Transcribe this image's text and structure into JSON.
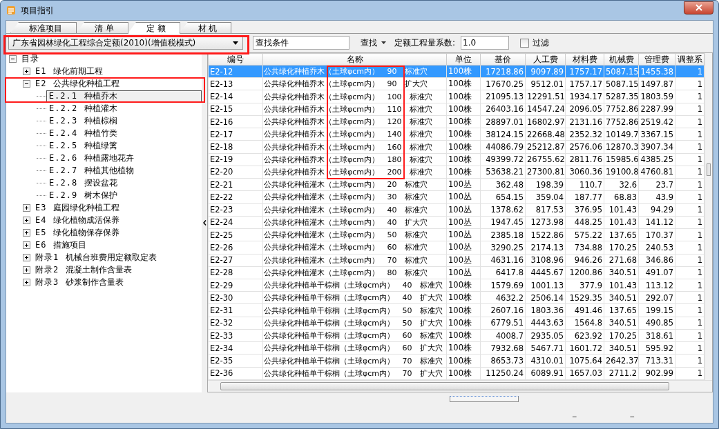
{
  "window": {
    "title": "项目指引"
  },
  "tabs": [
    {
      "label": "标准项目",
      "selected": false
    },
    {
      "label": "清 单",
      "selected": false
    },
    {
      "label": "定 额",
      "selected": true
    },
    {
      "label": "材 机",
      "selected": false
    }
  ],
  "toolbar": {
    "scheme": "广东省园林绿化工程综合定额(2010)(增值税模式)",
    "search": {
      "value": "查找条件"
    },
    "find_button": "查找",
    "coef_label": "定额工程量系数:",
    "coef_value": "1.0",
    "filter": {
      "label": "过滤",
      "checked": false
    }
  },
  "tree": [
    {
      "code": "目录",
      "expanded": true,
      "selected": false,
      "children": [
        {
          "code": "E1",
          "label": "绿化前期工程",
          "expanded": false,
          "selected": false
        },
        {
          "code": "E2",
          "label": "公共绿化种植工程",
          "expanded": true,
          "selected": false,
          "children": [
            {
              "code": "E.2.1",
              "label": "种植乔木",
              "selected": true
            },
            {
              "code": "E.2.2",
              "label": "种植灌木",
              "selected": false
            },
            {
              "code": "E.2.3",
              "label": "种植棕榈",
              "selected": false
            },
            {
              "code": "E.2.4",
              "label": "种植竹类",
              "selected": false
            },
            {
              "code": "E.2.5",
              "label": "种植绿篱",
              "selected": false
            },
            {
              "code": "E.2.6",
              "label": "种植露地花卉",
              "selected": false
            },
            {
              "code": "E.2.7",
              "label": "种植其他植物",
              "selected": false
            },
            {
              "code": "E.2.8",
              "label": "摆设盆花",
              "selected": false
            },
            {
              "code": "E.2.9",
              "label": "树木保护",
              "selected": false
            }
          ]
        },
        {
          "code": "E3",
          "label": "庭园绿化种植工程",
          "expanded": false,
          "selected": false
        },
        {
          "code": "E4",
          "label": "绿化植物成活保养",
          "expanded": false,
          "selected": false
        },
        {
          "code": "E5",
          "label": "绿化植物保存保养",
          "expanded": false,
          "selected": false
        },
        {
          "code": "E6",
          "label": "措施项目",
          "expanded": false,
          "selected": false
        },
        {
          "code": "附录1",
          "label": "机械台班费用定额取定表",
          "expanded": false,
          "selected": false
        },
        {
          "code": "附录2",
          "label": "混凝土制作含量表",
          "expanded": false,
          "selected": false
        },
        {
          "code": "附录3",
          "label": "砂浆制作含量表",
          "expanded": false,
          "selected": false
        }
      ]
    }
  ],
  "table": {
    "columns": [
      "编号",
      "名称",
      "单位",
      "基价",
      "人工费",
      "材料费",
      "机械费",
      "管理费",
      "调整系"
    ],
    "rows": [
      {
        "selected": true,
        "cells": [
          "E2-12",
          "公共绿化种植乔木（土球φcm内） 90 标准穴",
          "100株",
          "17218.86",
          "9097.89",
          "1757.17",
          "5087.15",
          "1455.38",
          "1"
        ]
      },
      {
        "selected": false,
        "cells": [
          "E2-13",
          "公共绿化种植乔木（土球φcm内） 90 扩大穴",
          "100株",
          "17670.25",
          "9512.01",
          "1757.17",
          "5087.15",
          "1497.87",
          "1"
        ]
      },
      {
        "selected": false,
        "cells": [
          "E2-14",
          "公共绿化种植乔木（土球φcm内） 100 标准穴",
          "100株",
          "21095.13",
          "12291.51",
          "1934.17",
          "5287.35",
          "1803.59",
          "1"
        ]
      },
      {
        "selected": false,
        "cells": [
          "E2-15",
          "公共绿化种植乔木（土球φcm内） 110 标准穴",
          "100株",
          "26403.16",
          "14547.24",
          "2096.05",
          "7752.86",
          "2287.99",
          "1"
        ]
      },
      {
        "selected": false,
        "cells": [
          "E2-16",
          "公共绿化种植乔木（土球φcm内） 120 标准穴",
          "100株",
          "28897.01",
          "16802.97",
          "2131.16",
          "7752.86",
          "2519.42",
          "1"
        ]
      },
      {
        "selected": false,
        "cells": [
          "E2-17",
          "公共绿化种植乔木（土球φcm内） 140 标准穴",
          "100株",
          "38124.15",
          "22668.48",
          "2352.32",
          "10149.7",
          "3367.15",
          "1"
        ]
      },
      {
        "selected": false,
        "cells": [
          "E2-18",
          "公共绿化种植乔木（土球φcm内） 160 标准穴",
          "100株",
          "44086.79",
          "25212.87",
          "2576.06",
          "12870.3",
          "3907.34",
          "1"
        ]
      },
      {
        "selected": false,
        "cells": [
          "E2-19",
          "公共绿化种植乔木（土球φcm内） 180 标准穴",
          "100株",
          "49399.72",
          "26755.62",
          "2811.76",
          "15985.6",
          "4385.25",
          "1"
        ]
      },
      {
        "selected": false,
        "cells": [
          "E2-20",
          "公共绿化种植乔木（土球φcm内） 200 标准穴",
          "100株",
          "53638.21",
          "27300.81",
          "3060.36",
          "19100.8",
          "4760.81",
          "1"
        ]
      },
      {
        "selected": false,
        "cells": [
          "E2-21",
          "公共绿化种植灌木（土球φcm内） 20 标准穴",
          "100丛",
          "362.48",
          "198.39",
          "110.7",
          "32.6",
          "23.7",
          "1"
        ]
      },
      {
        "selected": false,
        "cells": [
          "E2-22",
          "公共绿化种植灌木（土球φcm内） 30 标准穴",
          "100丛",
          "654.15",
          "359.04",
          "187.77",
          "68.83",
          "43.9",
          "1"
        ]
      },
      {
        "selected": false,
        "cells": [
          "E2-23",
          "公共绿化种植灌木（土球φcm内） 40 标准穴",
          "100丛",
          "1378.62",
          "817.53",
          "376.95",
          "101.43",
          "94.29",
          "1"
        ]
      },
      {
        "selected": false,
        "cells": [
          "E2-24",
          "公共绿化种植灌木（土球φcm内） 40 扩大穴",
          "100丛",
          "1947.45",
          "1273.98",
          "448.25",
          "101.43",
          "141.12",
          "1"
        ]
      },
      {
        "selected": false,
        "cells": [
          "E2-25",
          "公共绿化种植灌木（土球φcm内） 50 标准穴",
          "100丛",
          "2385.18",
          "1522.86",
          "575.22",
          "137.65",
          "170.37",
          "1"
        ]
      },
      {
        "selected": false,
        "cells": [
          "E2-26",
          "公共绿化种植灌木（土球φcm内） 60 标准穴",
          "100丛",
          "3290.25",
          "2174.13",
          "734.88",
          "170.25",
          "240.53",
          "1"
        ]
      },
      {
        "selected": false,
        "cells": [
          "E2-27",
          "公共绿化种植灌木（土球φcm内） 70 标准穴",
          "100丛",
          "4631.16",
          "3108.96",
          "946.26",
          "271.68",
          "346.86",
          "1"
        ]
      },
      {
        "selected": false,
        "cells": [
          "E2-28",
          "公共绿化种植灌木（土球φcm内） 80 标准穴",
          "100丛",
          "6417.8",
          "4445.67",
          "1200.86",
          "340.51",
          "491.07",
          "1"
        ]
      },
      {
        "selected": false,
        "cells": [
          "E2-29",
          "公共绿化种植单干棕榈（土球φcm内） 40 标准穴",
          "100株",
          "1579.69",
          "1001.13",
          "377.9",
          "101.43",
          "113.12",
          "1"
        ]
      },
      {
        "selected": false,
        "cells": [
          "E2-30",
          "公共绿化种植单干棕榈（土球φcm内） 40 扩大穴",
          "100株",
          "4632.2",
          "2506.14",
          "1529.35",
          "340.51",
          "292.07",
          "1"
        ]
      },
      {
        "selected": false,
        "cells": [
          "E2-31",
          "公共绿化种植单干棕榈（土球φcm内） 50 标准穴",
          "100株",
          "2607.16",
          "1803.36",
          "491.46",
          "137.65",
          "199.15",
          "1"
        ]
      },
      {
        "selected": false,
        "cells": [
          "E2-32",
          "公共绿化种植单干棕榈（土球φcm内） 50 扩大穴",
          "100株",
          "6779.51",
          "4443.63",
          "1564.8",
          "340.51",
          "490.85",
          "1"
        ]
      },
      {
        "selected": false,
        "cells": [
          "E2-33",
          "公共绿化种植单干棕榈（土球φcm内） 60 标准穴",
          "100株",
          "4008.7",
          "2935.05",
          "623.92",
          "170.25",
          "318.61",
          "1"
        ]
      },
      {
        "selected": false,
        "cells": [
          "E2-34",
          "公共绿化种植单干棕榈（土球φcm内） 60 扩大穴",
          "100株",
          "7932.68",
          "5467.71",
          "1601.72",
          "340.51",
          "595.92",
          "1"
        ]
      },
      {
        "selected": false,
        "cells": [
          "E2-35",
          "公共绿化种植单干棕榈（土球φcm内） 70 标准穴",
          "100株",
          "8653.73",
          "4310.01",
          "1075.64",
          "2642.37",
          "713.31",
          "1"
        ]
      },
      {
        "selected": false,
        "cells": [
          "E2-36",
          "公共绿化种植单干棕榈（土球φcm内） 70 扩大穴",
          "100株",
          "11250.24",
          "6089.91",
          "1657.03",
          "2711.2",
          "902.99",
          "1"
        ]
      }
    ]
  },
  "footer": {
    "marks": [
      "_",
      "_"
    ]
  }
}
